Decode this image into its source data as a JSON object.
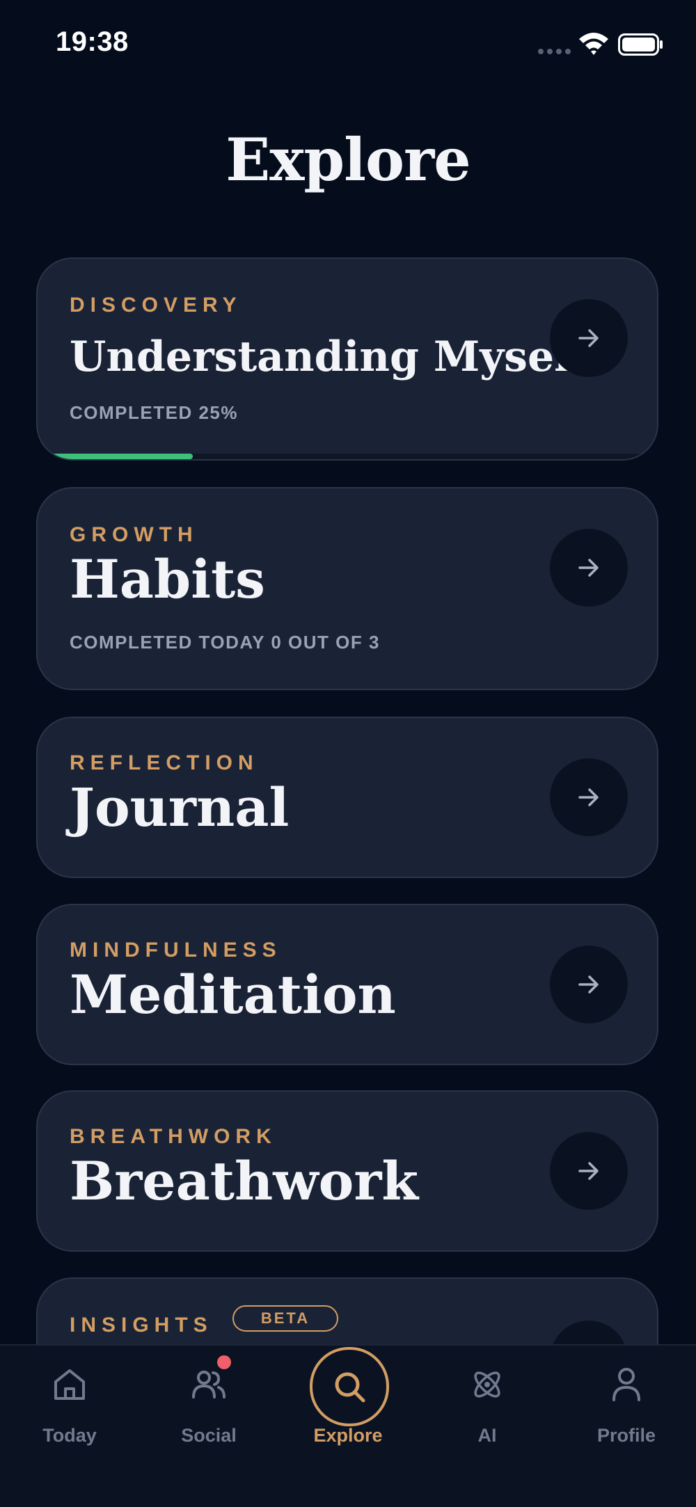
{
  "status": {
    "time": "19:38"
  },
  "page": {
    "title": "Explore"
  },
  "colors": {
    "accent": "#d39d63",
    "progress": "#3ec07a",
    "card_bg": "#1a2336",
    "background": "#050d1c",
    "notification": "#f0606a"
  },
  "cards": [
    {
      "category": "DISCOVERY",
      "title": "Understanding Myself",
      "subtitle": "COMPLETED 25%",
      "progress": 0.25,
      "icon": "arrow-right-icon"
    },
    {
      "category": "GROWTH",
      "title": "Habits",
      "subtitle": "COMPLETED TODAY 0 OUT OF 3",
      "icon": "arrow-right-icon"
    },
    {
      "category": "REFLECTION",
      "title": "Journal",
      "icon": "arrow-right-icon"
    },
    {
      "category": "MINDFULNESS",
      "title": "Meditation",
      "icon": "arrow-right-icon"
    },
    {
      "category": "BREATHWORK",
      "title": "Breathwork",
      "icon": "arrow-right-icon"
    },
    {
      "category": "INSIGHTS",
      "badge": "BETA",
      "icon": "arrow-right-icon"
    }
  ],
  "tabs": [
    {
      "label": "Today",
      "icon": "home-icon"
    },
    {
      "label": "Social",
      "icon": "users-icon",
      "notification": true
    },
    {
      "label": "Explore",
      "icon": "search-icon",
      "active": true
    },
    {
      "label": "AI",
      "icon": "atom-icon"
    },
    {
      "label": "Profile",
      "icon": "user-icon"
    }
  ]
}
